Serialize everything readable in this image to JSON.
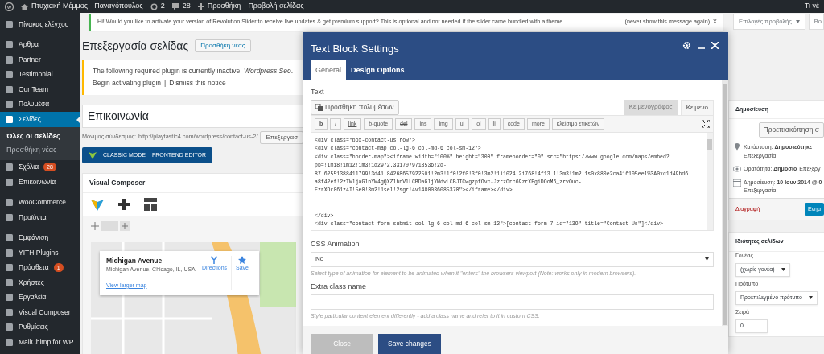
{
  "admin_bar": {
    "site_title": "Πτυχιακή Μέμμος - Παναγόπουλος",
    "updates": "2",
    "comments": "28",
    "new": "Προσθήκη",
    "view": "Προβολή σελίδας",
    "right_text": "Τι νέ"
  },
  "sidebar": {
    "groups": [
      [
        {
          "label": "Πίνακας ελέγχου",
          "selected": false
        }
      ],
      [
        {
          "label": "Άρθρα",
          "selected": false
        },
        {
          "label": "Partner",
          "selected": false
        },
        {
          "label": "Testimonial",
          "selected": false
        },
        {
          "label": "Our Team",
          "selected": false
        },
        {
          "label": "Πολυμέσα",
          "selected": false
        },
        {
          "label": "Σελίδες",
          "selected": true,
          "children": [
            {
              "label": "Όλες οι σελίδες",
              "selected": true
            },
            {
              "label": "Προσθήκη νέας",
              "selected": false
            }
          ]
        },
        {
          "label": "Σχόλια",
          "selected": false,
          "badge": "28"
        },
        {
          "label": "Επικοινωνία",
          "selected": false
        }
      ],
      [
        {
          "label": "WooCommerce",
          "selected": false
        },
        {
          "label": "Προϊόντα",
          "selected": false
        }
      ],
      [
        {
          "label": "Εμφάνιση",
          "selected": false
        },
        {
          "label": "YITH Plugins",
          "selected": false
        },
        {
          "label": "Πρόσθετα",
          "selected": false,
          "badge": "1"
        },
        {
          "label": "Χρήστες",
          "selected": false
        },
        {
          "label": "Εργαλεία",
          "selected": false
        },
        {
          "label": "Visual Composer",
          "selected": false
        },
        {
          "label": "Ρυθμίσεις",
          "selected": false
        },
        {
          "label": "MailChimp for WP",
          "selected": false
        }
      ]
    ]
  },
  "notice": {
    "text": "Hi! Would you like to activate your version of Revolution Slider to receive live updates & get premium support? This is optional and not needed if the slider came bundled with a theme.",
    "link": "(never show this message again)",
    "dismiss": "X"
  },
  "screen_options": [
    "Επιλογές προβολής",
    "Βο"
  ],
  "page_heading": {
    "title": "Επεξεργασία σελίδας",
    "add_new": "Προσθήκη νέας"
  },
  "plugin_notice": {
    "text_before": "The following required plugin is currently inactive: ",
    "link": "Wordpress Seo",
    "text_after": ".",
    "links": [
      "Begin activating plugin",
      "Dismiss this notice"
    ],
    "separator": "|"
  },
  "post_title": "Επικοινωνία",
  "permalink": {
    "label": "Μόνιμος σύνδεσμος:",
    "url": "http://playtastic4.com/wordpress/contact-us-2/",
    "edit": "Επεξεργασ"
  },
  "vc_switch": [
    "CLASSIC MODE",
    "FRONTEND EDITOR"
  ],
  "visual_composer": {
    "title": "Visual Composer",
    "map_card": {
      "name": "Michigan Avenue",
      "address": "Michigan Avenue, Chicago, IL, USA",
      "directions": "Directions",
      "save": "Save",
      "larger": "View larger map"
    }
  },
  "publish": {
    "title": "Δημοσίευση",
    "preview": "Προεπισκόπηση σ",
    "rows": [
      {
        "text": "Κατάσταση: **Δημοσιεύτηκε**",
        "link": "Επεξεργασία"
      },
      {
        "text": "Ορατότητα: **Δημόσιο**",
        "link": "Επεξεργ"
      },
      {
        "text": "Δημοσίευση: **10 Ιουν 2014 @ 0**",
        "link": "Επεξεργασία"
      }
    ],
    "delete": "Διαγραφή",
    "update": "Ενημ"
  },
  "page_attributes": {
    "title": "Ιδιότητες σελίδων",
    "fields": [
      {
        "kind": "select",
        "label": "Γονέας",
        "value": "(χωρίς γονέα)"
      },
      {
        "kind": "select",
        "label": "Πρότυπο",
        "value": "Προεπιλεγμένο πρότυπο"
      },
      {
        "kind": "input",
        "label": "Σειρά",
        "value": "0"
      }
    ]
  },
  "modal": {
    "title": "Text Block Settings",
    "tabs": [
      {
        "label": "General",
        "selected": true
      },
      {
        "label": "Design Options",
        "selected": false
      }
    ],
    "text_label": "Text",
    "add_media": "Προσθήκη πολυμέσων",
    "editor_tabs": [
      {
        "label": "Κειμενογράφος",
        "selected": false
      },
      {
        "label": "Κείμενο",
        "selected": true
      }
    ],
    "quicktags": [
      "b",
      "i",
      "link",
      "b-quote",
      "del",
      "ins",
      "img",
      "ul",
      "ol",
      "li",
      "code",
      "more",
      "κλείσιμο ετικετών"
    ],
    "code": "<div class=\"box-contact-us row\">\n<div class=\"contact-map col-lg-6 col-md-6 col-sm-12\">\n<div class=\"border-map\"><iframe width=\"100%\" height=\"300\" frameborder=\"0\" src=\"https://www.google.com/maps/embed?\npb=!1m18!1m12!1m3!1d2972.3317079718536!2d-\n87.62551388411799!3d41.84268657922501!2m3!1f0!2f0!3f0!3m2!1i1024!2i768!4f13.1!3m3!1m2!1s0x880e2ca416105ee1%3A0xc1d49bd6\na8f42ef!2zTWljaGlnYW4gQXZlbnVlLCBDaGljYWdvLCBJTCwgzpfOvc-JzrzOrc69zrXPgiDOoM6_zrvOuc-\nEzrXOr861z4I!5e0!3m2!1sel!2sgr!4v1480036085370\"></iframe></div>\n\n\n</div>\n<div class=\"contact-form-submit col-lg-6 col-md-6 col-sm-12\">[contact-form-7 id=\"139\" title=\"Contact Us\"]</div>",
    "fields": [
      {
        "kind": "select",
        "label": "CSS Animation",
        "value": "No",
        "help": "Select type of animation for element to be animated when it \"enters\" the browsers viewport (Note: works only in modern browsers)."
      },
      {
        "kind": "input",
        "label": "Extra class name",
        "help": "Style particular content element differently - add a class name and refer to it in custom CSS."
      }
    ],
    "buttons": [
      {
        "label": "Close",
        "kind": "secondary"
      },
      {
        "label": "Save changes",
        "kind": "primary"
      }
    ]
  }
}
